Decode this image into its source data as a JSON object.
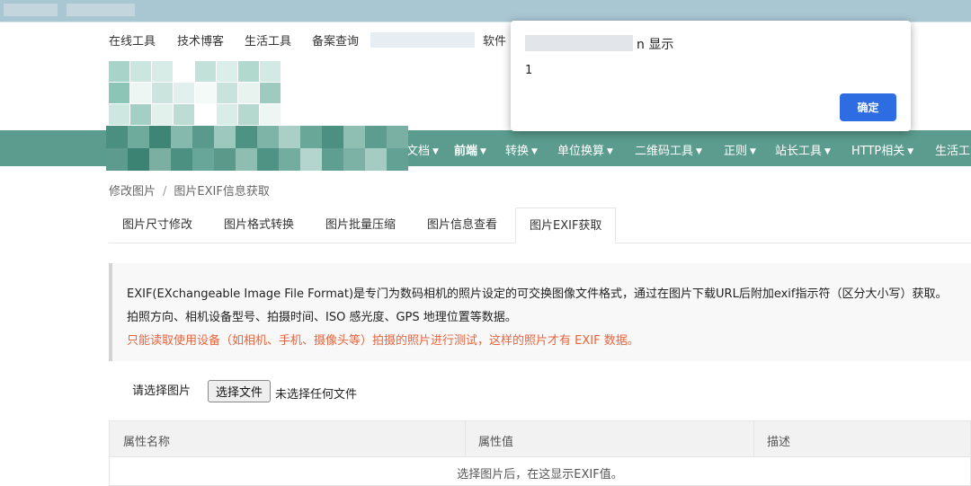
{
  "topbar": {
    "links": [
      "在线工具",
      "技术博客",
      "生活工具",
      "备案查询"
    ],
    "software": "软件"
  },
  "nav": {
    "items": [
      {
        "label": "文档",
        "active": false
      },
      {
        "label": "前端",
        "active": true
      },
      {
        "label": "转换",
        "active": false
      },
      {
        "label": "单位换算",
        "active": false
      },
      {
        "label": "二维码工具",
        "active": false
      },
      {
        "label": "正则",
        "active": false
      },
      {
        "label": "站长工具",
        "active": false
      },
      {
        "label": "HTTP相关",
        "active": false
      },
      {
        "label": "生活工",
        "active": false
      }
    ],
    "caret": "▼"
  },
  "breadcrumb": {
    "parent": "修改图片",
    "separator": "/",
    "current": "图片EXIF信息获取"
  },
  "tabs": [
    {
      "label": "图片尺寸修改",
      "active": false
    },
    {
      "label": "图片格式转换",
      "active": false
    },
    {
      "label": "图片批量压缩",
      "active": false
    },
    {
      "label": "图片信息查看",
      "active": false
    },
    {
      "label": "图片EXIF获取",
      "active": true
    }
  ],
  "info": {
    "line1": "EXIF(EXchangeable Image File Format)是专门为数码相机的照片设定的可交换图像文件格式，通过在图片下载URL后附加exif指示符（区分大小写）获取。",
    "line2": "拍照方向、相机设备型号、拍摄时间、ISO 感光度、GPS 地理位置等数据。",
    "warning": "只能读取使用设备（如相机、手机、摄像头等）拍摄的照片进行测试，这样的照片才有 EXIF 数据。"
  },
  "upload": {
    "label": "请选择图片",
    "button": "选择文件",
    "status": "未选择任何文件"
  },
  "table": {
    "headers": [
      "属性名称",
      "属性值",
      "描述"
    ],
    "empty": "选择图片后，在这显示EXIF值。"
  },
  "dialog": {
    "title_suffix": "n 显示",
    "message": "1",
    "ok": "确定"
  },
  "colors": {
    "nav": "#5b9c8e",
    "accent": "#2d6ce1",
    "warning": "#e8643c"
  }
}
